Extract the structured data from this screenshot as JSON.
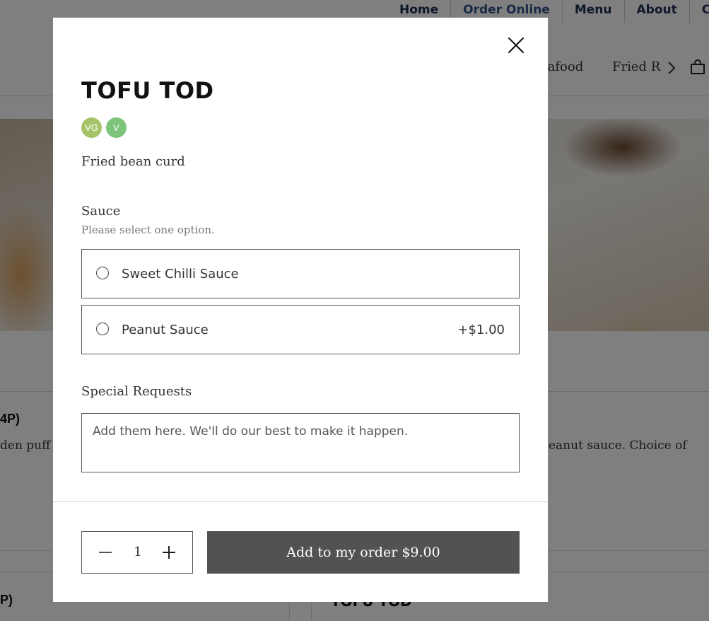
{
  "background": {
    "nav": [
      "Home",
      "Order Online",
      "Menu",
      "About",
      "Cor"
    ],
    "categories": [
      "eafood",
      "Fried R"
    ],
    "left_item_title": "4P)",
    "left_item_desc": "den puff p",
    "right_item_desc": "eanut sauce. Choice of",
    "left_item_title2": "P)",
    "right_item_title2": "TOFU TOD"
  },
  "modal": {
    "title": "TOFU TOD",
    "badges": [
      {
        "label": "VG",
        "color": "#a7c36a"
      },
      {
        "label": "V",
        "color": "#7dc57a"
      }
    ],
    "description": "Fried bean curd",
    "sauce": {
      "title": "Sauce",
      "subtitle": "Please select one option.",
      "options": [
        {
          "label": "Sweet Chilli Sauce",
          "price": ""
        },
        {
          "label": "Peanut Sauce",
          "price": "+$1.00"
        }
      ]
    },
    "special_requests": {
      "title": "Special Requests",
      "placeholder": "Add them here. We'll do our best to make it happen."
    },
    "quantity": "1",
    "add_button": "Add to my order $9.00"
  }
}
